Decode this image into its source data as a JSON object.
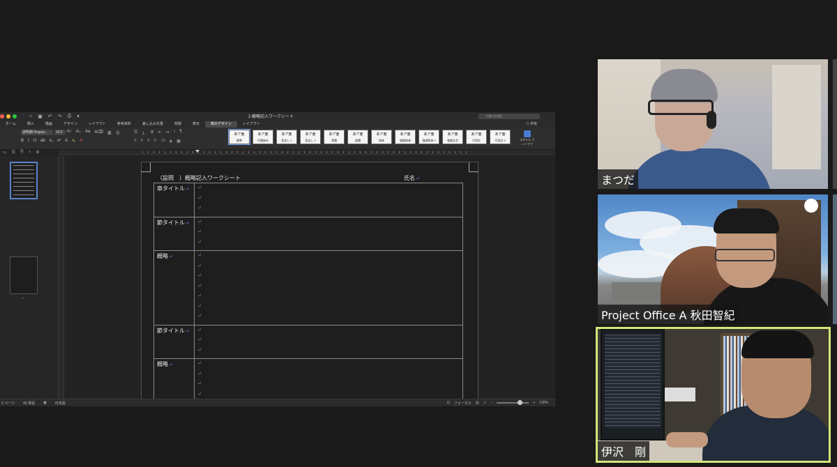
{
  "word": {
    "doc_title": "2.概略記入ワークシート",
    "search_placeholder": "文書内を検索",
    "tabs": [
      "ホーム",
      "挿入",
      "描画",
      "デザイン",
      "レイアウト",
      "参考資料",
      "差し込み文書",
      "校閲",
      "表示",
      "表のデザイン",
      "レイアウト"
    ],
    "active_tab": "表のデザイン",
    "share_label": "共有",
    "font": "游明朝 Regula...",
    "font_size": "10.5",
    "styles": [
      {
        "sample": "あア亜",
        "name": "標準"
      },
      {
        "sample": "あア亜",
        "name": "行間詰め"
      },
      {
        "sample": "あア亜",
        "name": "見出し 1"
      },
      {
        "sample": "あア亜",
        "name": "見出し 2"
      },
      {
        "sample": "あア亜",
        "name": "表題"
      },
      {
        "sample": "あア亜",
        "name": "副題"
      },
      {
        "sample": "あア亜",
        "name": "斜体"
      },
      {
        "sample": "あア亜",
        "name": "強調斜体"
      },
      {
        "sample": "あア亜",
        "name": "強調斜体 2"
      },
      {
        "sample": "あア亜",
        "name": "強調太字"
      },
      {
        "sample": "あア亜",
        "name": "引用文"
      },
      {
        "sample": "あア亜",
        "name": "引用文 2"
      }
    ],
    "style_pane": "スタイル ウィンドウ",
    "thumb_page2": "2",
    "worksheet": {
      "title": "（設問　）概略記入ワークシート",
      "name_label": "氏名",
      "rows": [
        {
          "label": "章タイトル",
          "lines": 3
        },
        {
          "label": "節タイトル",
          "lines": 3
        },
        {
          "label": "概略",
          "lines": 7
        },
        {
          "label": "節タイトル",
          "lines": 3
        },
        {
          "label": "概略",
          "lines": 5
        }
      ]
    },
    "status": {
      "page": "2 ページ",
      "words": "49 単語",
      "lang": "日本語",
      "focus": "フォーカス",
      "zoom": "130%"
    }
  },
  "participants": [
    {
      "name": "まつだ"
    },
    {
      "name": "Project Office A 秋田智紀"
    },
    {
      "name": "伊沢　剛"
    }
  ],
  "colors": {
    "active_speaker_border": "#d3e77a",
    "accent_blue": "#5b84c9"
  }
}
